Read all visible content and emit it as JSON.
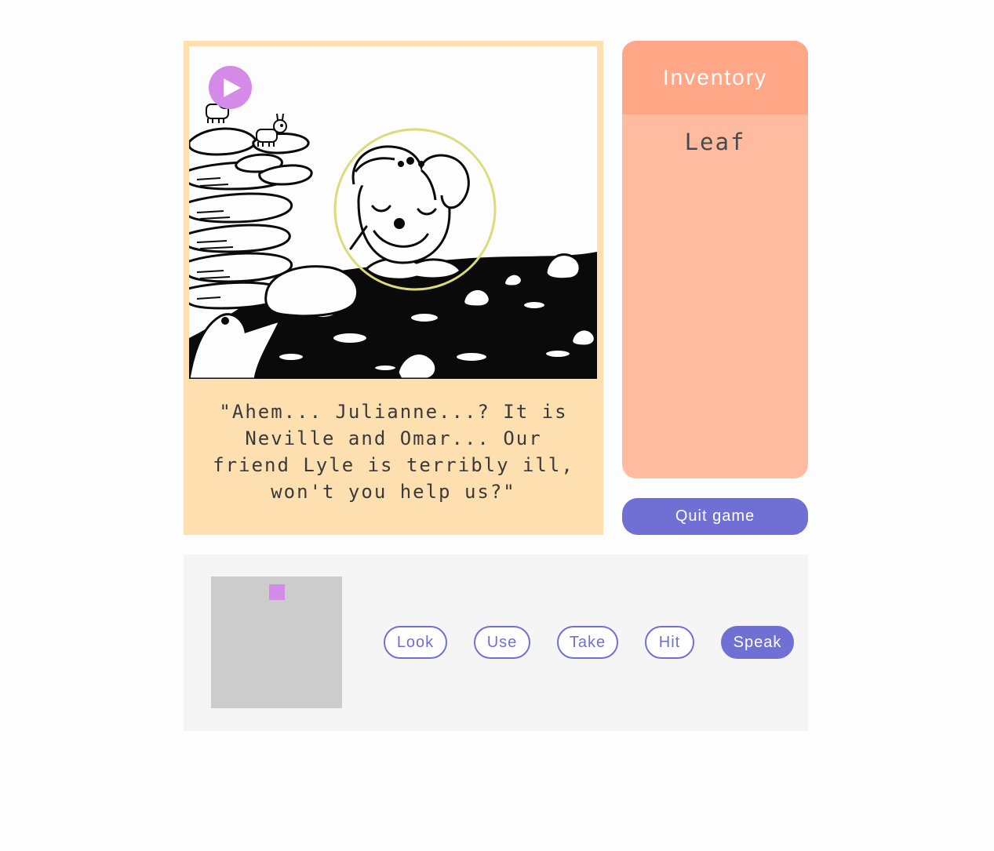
{
  "scene": {
    "play_icon": "play-icon",
    "dialogue": "\"Ahem... Julianne...? It is Neville and Omar... Our friend Lyle is terribly ill, won't you help us?\""
  },
  "inventory": {
    "title": "Inventory",
    "items": [
      {
        "label": "Leaf"
      }
    ]
  },
  "quit_label": "Quit game",
  "verbs": {
    "look": "Look",
    "use": "Use",
    "take": "Take",
    "hit": "Hit",
    "speak": "Speak",
    "selected": "Speak"
  },
  "colors": {
    "accent": "#7070d4",
    "player_marker": "#d48be8",
    "inventory_header": "#ffa786",
    "inventory_body": "#ffbb9f",
    "scene_panel": "#fddfb0"
  }
}
